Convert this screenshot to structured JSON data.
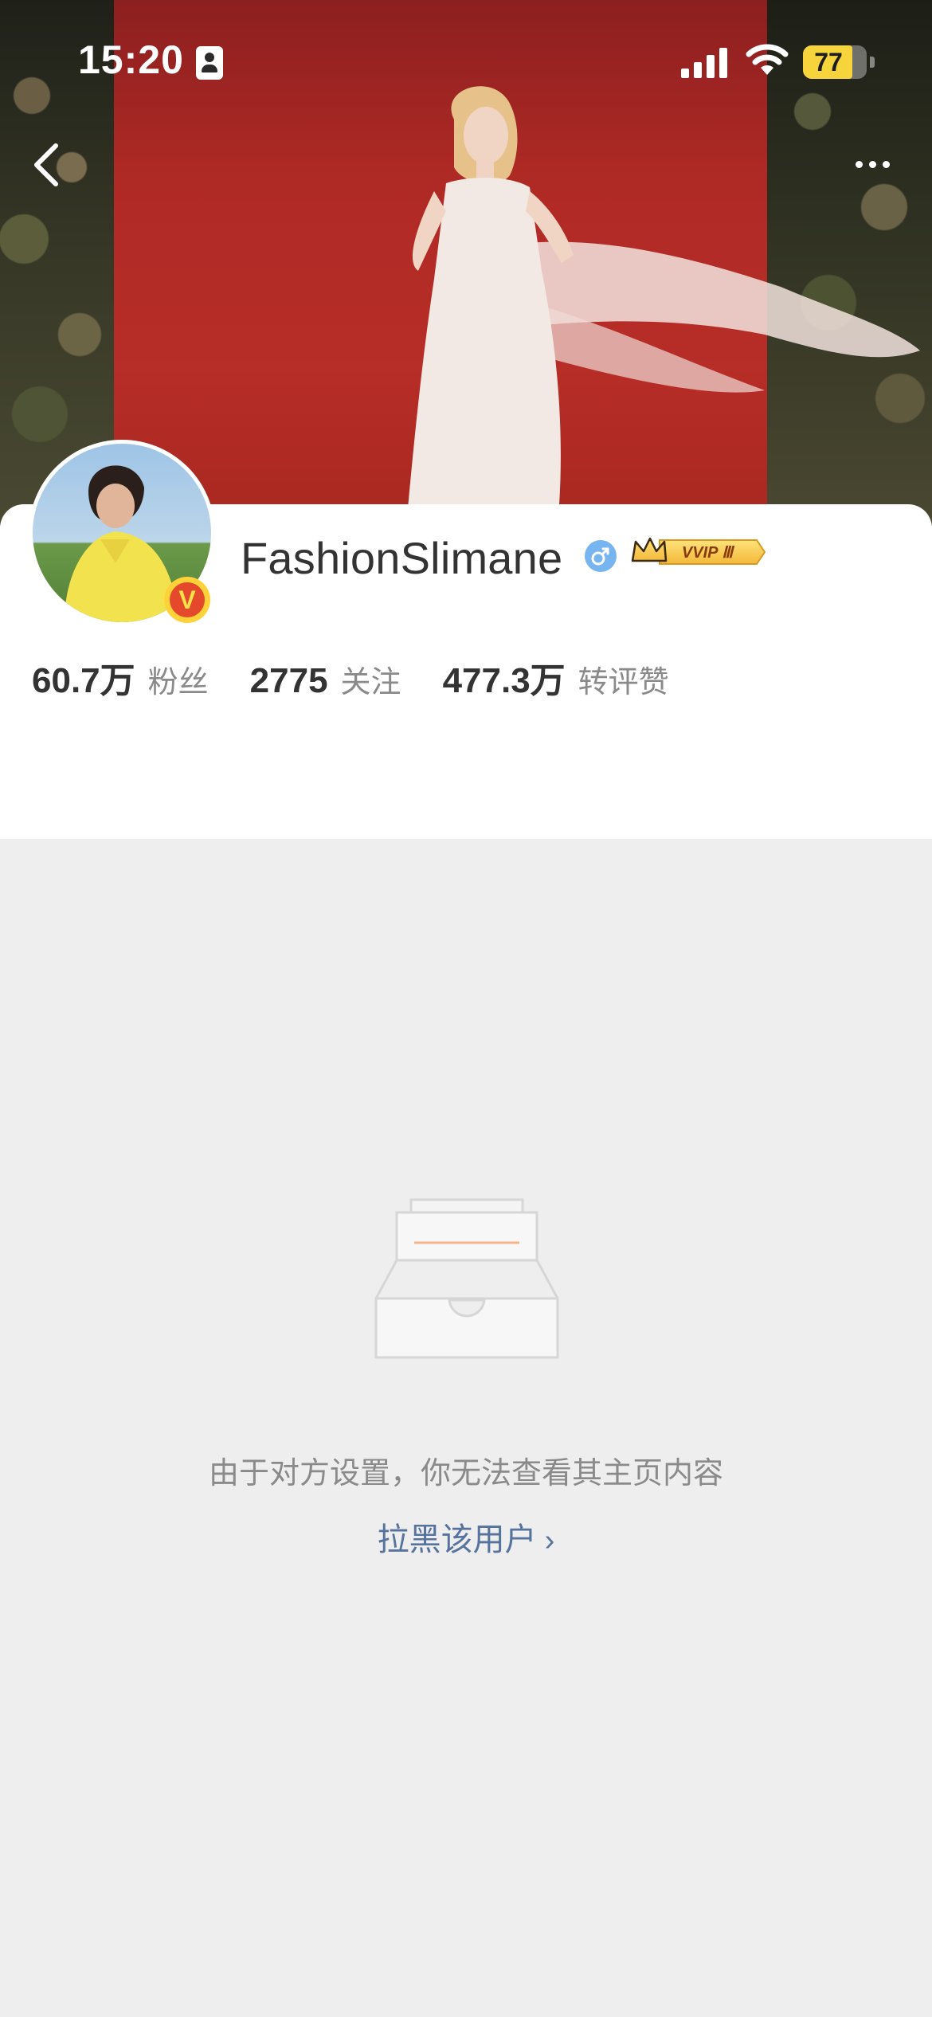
{
  "status_bar": {
    "time": "15:20",
    "battery": "77",
    "battery_level": 0.77,
    "icons": [
      "id-card-icon",
      "cellular-signal-icon",
      "wifi-icon",
      "battery-icon"
    ]
  },
  "nav": {
    "back_icon": "chevron-left-icon",
    "more_icon": "more-horizontal-icon"
  },
  "profile": {
    "username": "FashionSlimane",
    "gender_icon": "male-icon",
    "verified_icon": "verified-v-icon",
    "verified_label": "V",
    "vip_badge": "VVIP Ⅲ",
    "stats": [
      {
        "value": "60.7万",
        "label": "粉丝"
      },
      {
        "value": "2775",
        "label": "关注"
      },
      {
        "value": "477.3万",
        "label": "转评赞"
      }
    ]
  },
  "empty_state": {
    "icon": "empty-box-icon",
    "message": "由于对方设置，你无法查看其主页内容",
    "block_link": "拉黑该用户",
    "block_link_icon": "chevron-right-icon"
  },
  "colors": {
    "accent_link": "#56739e",
    "battery_fill": "#f7d43b",
    "verified_badge": "#e5492b",
    "background": "#eeeeee",
    "card": "#ffffff"
  }
}
